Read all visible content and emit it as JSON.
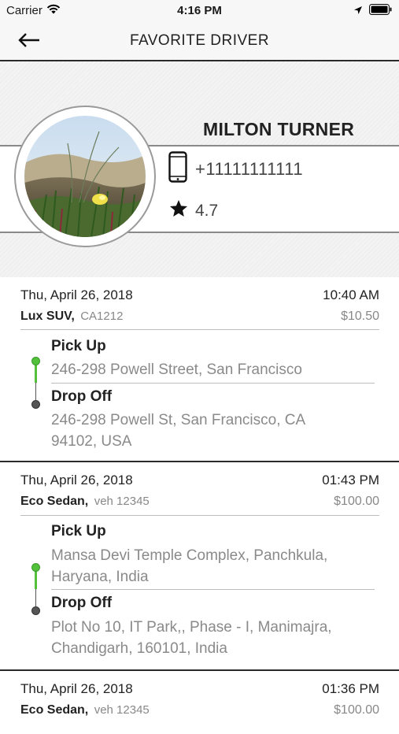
{
  "status_bar": {
    "carrier": "Carrier",
    "time": "4:16 PM"
  },
  "nav": {
    "title": "FAVORITE DRIVER"
  },
  "driver": {
    "name": "MILTON TURNER",
    "phone": "+11111111111",
    "rating": "4.7"
  },
  "rides": [
    {
      "date": "Thu, April 26, 2018",
      "time": "10:40 AM",
      "car_type": "Lux SUV,",
      "plate": "CA1212",
      "price": "$10.50",
      "pickup_label": "Pick Up",
      "pickup_address": "246-298 Powell Street, San Francisco",
      "dropoff_label": "Drop Off",
      "dropoff_address": "246-298 Powell St, San Francisco, CA 94102, USA"
    },
    {
      "date": "Thu, April 26, 2018",
      "time": "01:43 PM",
      "car_type": "Eco Sedan,",
      "plate": "veh 12345",
      "price": "$100.00",
      "pickup_label": "Pick Up",
      "pickup_address": "Mansa Devi Temple Complex, Panchkula, Haryana, India",
      "dropoff_label": "Drop Off",
      "dropoff_address": "Plot No 10, IT Park,, Phase - I, Manimajra, Chandigarh, 160101, India"
    },
    {
      "date": "Thu, April 26, 2018",
      "time": "01:36 PM",
      "car_type": "Eco Sedan,",
      "plate": "veh 12345",
      "price": "$100.00"
    }
  ],
  "icons": {
    "wifi": "wifi-icon",
    "location": "location-arrow-icon",
    "battery": "battery-icon",
    "back": "back-arrow-icon",
    "phone": "mobile-phone-icon",
    "star": "star-icon"
  },
  "colors": {
    "route_green": "#52c03a",
    "divider": "#2a2a2a",
    "muted_text": "#8a8a8a"
  }
}
